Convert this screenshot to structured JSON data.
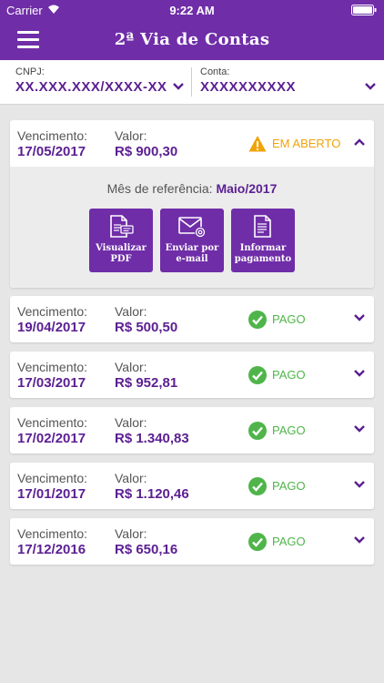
{
  "status_bar": {
    "carrier": "Carrier",
    "time": "9:22 AM"
  },
  "header": {
    "title": "2ª Via de Contas",
    "menu_icon": "hamburger-menu-icon"
  },
  "filters": {
    "cnpj_label": "CNPJ:",
    "cnpj_value": "XX.XXX.XXX/XXXX-XX",
    "conta_label": "Conta:",
    "conta_value": "XXXXXXXXXX"
  },
  "labels": {
    "vencimento": "Vencimento:",
    "valor": "Valor:"
  },
  "colors": {
    "brand": "#6f2da8",
    "open": "#f0a30a",
    "paid": "#4fb54a"
  },
  "open_bill": {
    "due": "17/05/2017",
    "amount": "R$ 900,30",
    "status": "EM ABERTO",
    "ref_label": "Mês de referência:",
    "ref_value": "Maio/2017",
    "actions": [
      {
        "line1": "Visualizar",
        "line2": "PDF",
        "icon": "pdf-document-icon"
      },
      {
        "line1": "Enviar por",
        "line2": "e-mail",
        "icon": "email-icon"
      },
      {
        "line1": "Informar",
        "line2": "pagamento",
        "icon": "payment-document-icon"
      }
    ]
  },
  "bills": [
    {
      "due": "19/04/2017",
      "amount": "R$ 500,50",
      "status": "PAGO"
    },
    {
      "due": "17/03/2017",
      "amount": "R$ 952,81",
      "status": "PAGO"
    },
    {
      "due": "17/02/2017",
      "amount": "R$ 1.340,83",
      "status": "PAGO"
    },
    {
      "due": "17/01/2017",
      "amount": "R$ 1.120,46",
      "status": "PAGO"
    },
    {
      "due": "17/12/2016",
      "amount": "R$ 650,16",
      "status": "PAGO"
    }
  ]
}
